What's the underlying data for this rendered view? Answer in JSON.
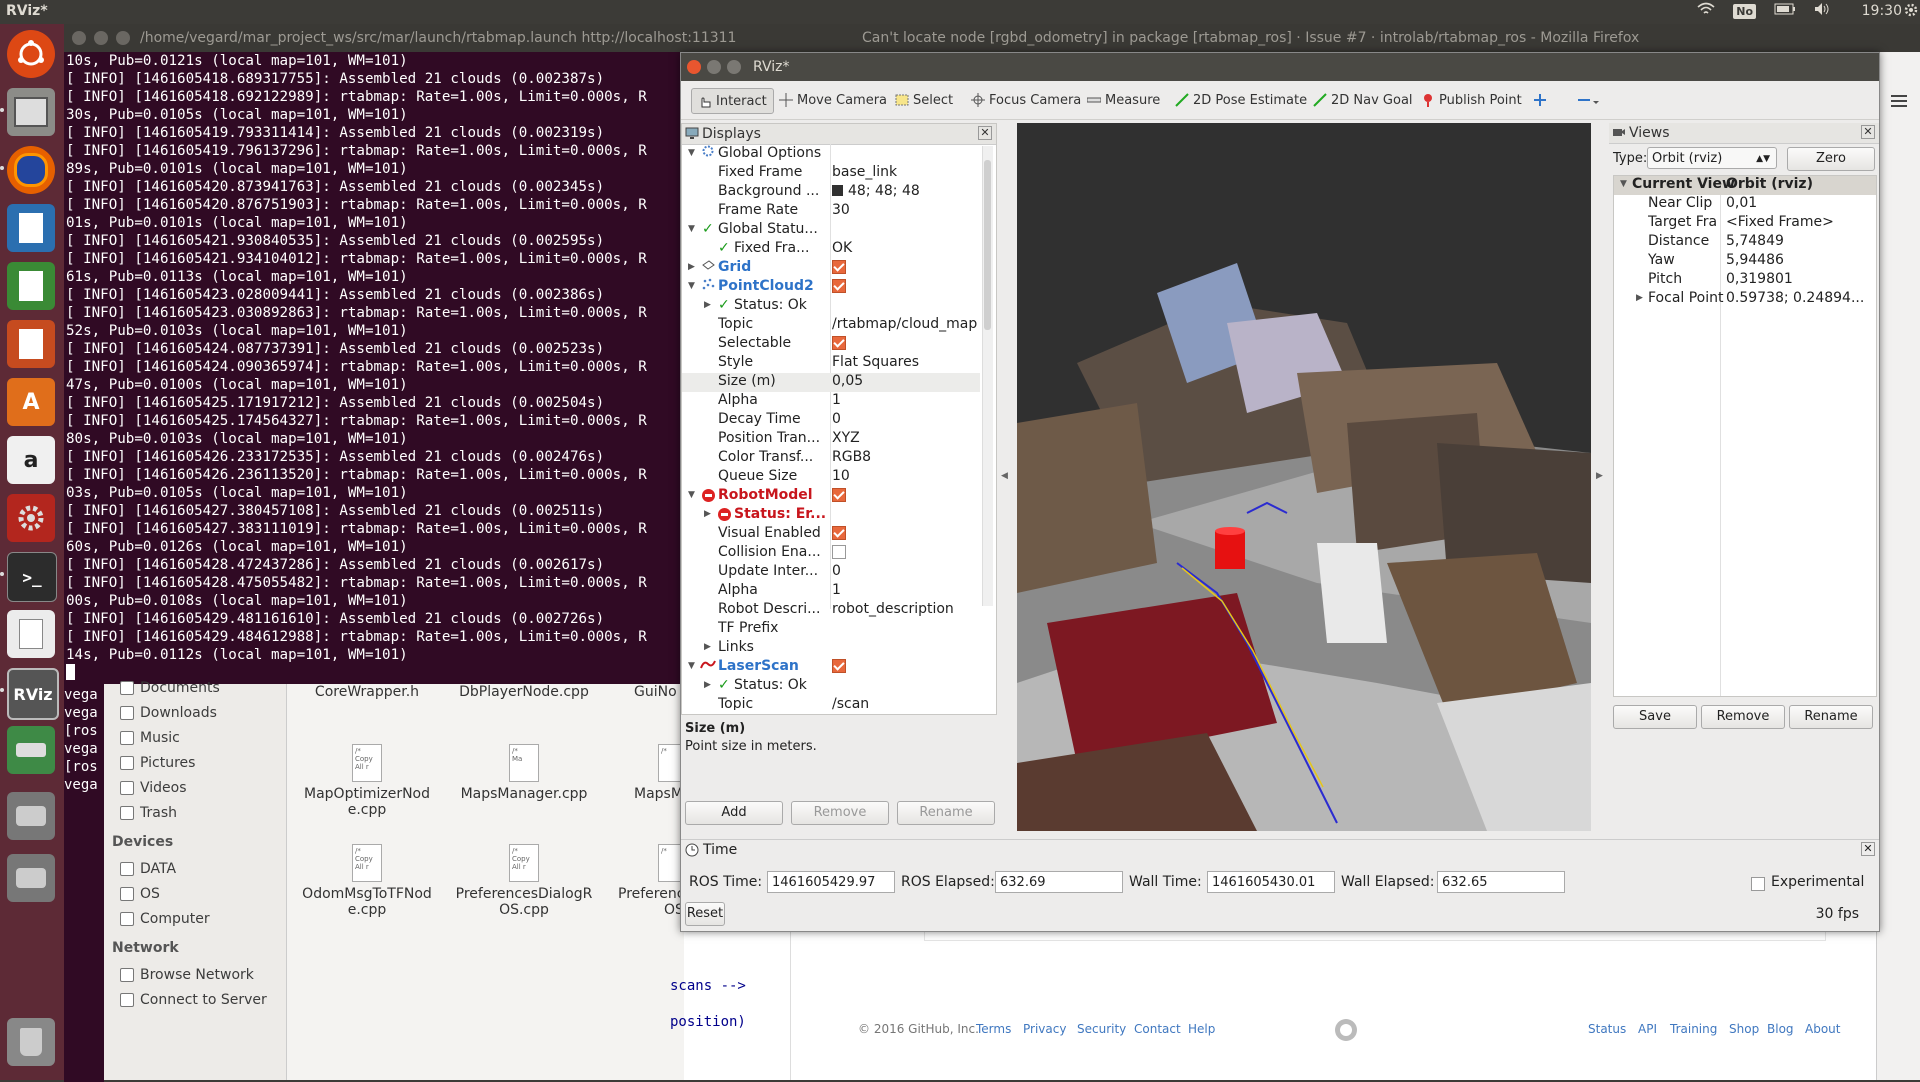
{
  "topbar": {
    "app_name": "RViz*",
    "kbd_layout": "No",
    "clock": "19:30"
  },
  "background": {
    "terminal_title": "/home/vegard/mar_project_ws/src/mar/launch/rtabmap.launch http://localhost:11311",
    "firefox_title": "Can't locate node [rgbd_odometry] in package [rtabmap_ros] · Issue #7 · introlab/rtabmap_ros - Mozilla Firefox",
    "terminal_lines": [
      "10s, Pub=0.0121s (local map=101, WM=101)",
      "[ INFO] [1461605418.689317755]: Assembled 21 clouds (0.002387s)",
      "[ INFO] [1461605418.692122989]: rtabmap: Rate=1.00s, Limit=0.000s, R",
      "30s, Pub=0.0105s (local map=101, WM=101)",
      "[ INFO] [1461605419.793311414]: Assembled 21 clouds (0.002319s)",
      "[ INFO] [1461605419.796137296]: rtabmap: Rate=1.00s, Limit=0.000s, R",
      "89s, Pub=0.0101s (local map=101, WM=101)",
      "[ INFO] [1461605420.873941763]: Assembled 21 clouds (0.002345s)",
      "[ INFO] [1461605420.876751903]: rtabmap: Rate=1.00s, Limit=0.000s, R",
      "01s, Pub=0.0101s (local map=101, WM=101)",
      "[ INFO] [1461605421.930840535]: Assembled 21 clouds (0.002595s)",
      "[ INFO] [1461605421.934104012]: rtabmap: Rate=1.00s, Limit=0.000s, R",
      "61s, Pub=0.0113s (local map=101, WM=101)",
      "[ INFO] [1461605423.028009441]: Assembled 21 clouds (0.002386s)",
      "[ INFO] [1461605423.030892863]: rtabmap: Rate=1.00s, Limit=0.000s, R",
      "52s, Pub=0.0103s (local map=101, WM=101)",
      "[ INFO] [1461605424.087737391]: Assembled 21 clouds (0.002523s)",
      "[ INFO] [1461605424.090365974]: rtabmap: Rate=1.00s, Limit=0.000s, R",
      "47s, Pub=0.0100s (local map=101, WM=101)",
      "[ INFO] [1461605425.171917212]: Assembled 21 clouds (0.002504s)",
      "[ INFO] [1461605425.174564327]: rtabmap: Rate=1.00s, Limit=0.000s, R",
      "80s, Pub=0.0103s (local map=101, WM=101)",
      "[ INFO] [1461605426.233172535]: Assembled 21 clouds (0.002476s)",
      "[ INFO] [1461605426.236113520]: rtabmap: Rate=1.00s, Limit=0.000s, R",
      "03s, Pub=0.0105s (local map=101, WM=101)",
      "[ INFO] [1461605427.380457108]: Assembled 21 clouds (0.002511s)",
      "[ INFO] [1461605427.383111019]: rtabmap: Rate=1.00s, Limit=0.000s, R",
      "60s, Pub=0.0126s (local map=101, WM=101)",
      "[ INFO] [1461605428.472437286]: Assembled 21 clouds (0.002617s)",
      "[ INFO] [1461605428.475055482]: rtabmap: Rate=1.00s, Limit=0.000s, R",
      "00s, Pub=0.0108s (local map=101, WM=101)",
      "[ INFO] [1461605429.481161610]: Assembled 21 clouds (0.002726s)",
      "[ INFO] [1461605429.484612988]: rtabmap: Rate=1.00s, Limit=0.000s, R",
      "14s, Pub=0.0112s (local map=101, WM=101)"
    ],
    "term_left_lines": [
      "vega",
      "vega",
      "[ros",
      "vega",
      "[ros",
      "vega"
    ],
    "places": {
      "documents": "Documents",
      "downloads": "Downloads",
      "music": "Music",
      "pictures": "Pictures",
      "videos": "Videos",
      "trash": "Trash"
    },
    "devices_header": "Devices",
    "devices": {
      "data": "DATA",
      "os": "OS",
      "computer": "Computer"
    },
    "network_header": "Network",
    "network": {
      "browse": "Browse Network",
      "connect": "Connect to Server"
    },
    "files": {
      "f1": "CoreWrapper.h",
      "f2": "DbPlayerNode.cpp",
      "f3": "GuiNo",
      "f4a": "MapOptimizerNod",
      "f4b": "e.cpp",
      "f5": "MapsManager.cpp",
      "f6": "MapsMa",
      "f7a": "OdomMsgToTFNod",
      "f7b": "e.cpp",
      "f8a": "PreferencesDialogR",
      "f8b": "OS.cpp",
      "f9a": "Preferenc",
      "f9b": "OS"
    },
    "github": {
      "code1": "scans -->",
      "code2": "position)",
      "copyright": "© 2016 GitHub, Inc.",
      "links_left": {
        "terms": "Terms",
        "privacy": "Privacy",
        "security": "Security",
        "contact": "Contact",
        "help": "Help"
      },
      "links_right": {
        "status": "Status",
        "api": "API",
        "training": "Training",
        "shop": "Shop",
        "blog": "Blog",
        "about": "About"
      }
    }
  },
  "rviz": {
    "title": "RViz*",
    "toolbar": {
      "interact": "Interact",
      "move_camera": "Move Camera",
      "select": "Select",
      "focus_camera": "Focus Camera",
      "measure": "Measure",
      "pose_estimate": "2D Pose Estimate",
      "nav_goal": "2D Nav Goal",
      "publish_point": "Publish Point"
    },
    "displays": {
      "title": "Displays",
      "global_options": "Global Options",
      "fixed_frame": "Fixed Frame",
      "fixed_frame_v": "base_link",
      "background": "Background ...",
      "background_v": "48; 48; 48",
      "frame_rate": "Frame Rate",
      "frame_rate_v": "30",
      "global_status": "Global Statu...",
      "fixed_fra": "Fixed Fra...",
      "fixed_fra_v": "OK",
      "grid": "Grid",
      "pointcloud2": "PointCloud2",
      "status_ok": "Status: Ok",
      "topic": "Topic",
      "topic_v": "/rtabmap/cloud_map",
      "selectable": "Selectable",
      "style": "Style",
      "style_v": "Flat Squares",
      "size": "Size (m)",
      "size_v": "0,05",
      "alpha": "Alpha",
      "alpha_v": "1",
      "decay": "Decay Time",
      "decay_v": "0",
      "position_tran": "Position Tran...",
      "position_tran_v": "XYZ",
      "color_transf": "Color Transf...",
      "color_transf_v": "RGB8",
      "queue": "Queue Size",
      "queue_v": "10",
      "robotmodel": "RobotModel",
      "status_err": "Status: Er...",
      "visual": "Visual Enabled",
      "collision": "Collision Ena...",
      "update": "Update Inter...",
      "update_v": "0",
      "alpha2": "Alpha",
      "alpha2_v": "1",
      "robot_desc": "Robot Descri...",
      "robot_desc_v": "robot_description",
      "tf_prefix": "TF Prefix",
      "links": "Links",
      "laserscan": "LaserScan",
      "status_ok2": "Status: Ok",
      "topic2": "Topic",
      "topic2_v": "/scan"
    },
    "help": {
      "title": "Size (m)",
      "text": "Point size in meters."
    },
    "display_buttons": {
      "add": "Add",
      "remove": "Remove",
      "rename": "Rename"
    },
    "views": {
      "title": "Views",
      "type_label": "Type:",
      "type_value": "Orbit (rviz)",
      "zero": "Zero",
      "current_view": "Current View",
      "current_view_v": "Orbit (rviz)",
      "near_clip": "Near Clip ...",
      "near_clip_v": "0,01",
      "target_frame": "Target Fra...",
      "target_frame_v": "<Fixed Frame>",
      "distance": "Distance",
      "distance_v": "5,74849",
      "yaw": "Yaw",
      "yaw_v": "5,94486",
      "pitch": "Pitch",
      "pitch_v": "0,319801",
      "focal": "Focal Point",
      "focal_v": "0.59738; 0.24894...",
      "save": "Save",
      "remove": "Remove",
      "rename": "Rename"
    },
    "time": {
      "title": "Time",
      "ros_time_label": "ROS Time:",
      "ros_time": "1461605429.97",
      "ros_elapsed_label": "ROS Elapsed:",
      "ros_elapsed": "632.69",
      "wall_time_label": "Wall Time:",
      "wall_time": "1461605430.01",
      "wall_elapsed_label": "Wall Elapsed:",
      "wall_elapsed": "632.65",
      "experimental": "Experimental",
      "reset": "Reset",
      "fps": "30 fps"
    }
  }
}
